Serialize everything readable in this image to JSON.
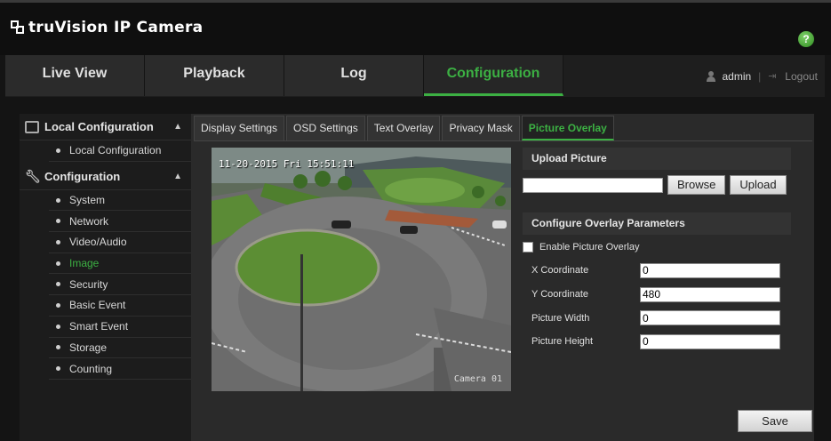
{
  "app": {
    "title": "truVision  IP Camera",
    "help_label": "?"
  },
  "nav": {
    "tabs": [
      {
        "label": "Live View"
      },
      {
        "label": "Playback"
      },
      {
        "label": "Log"
      },
      {
        "label": "Configuration"
      }
    ],
    "active_tab": "Configuration",
    "user": "admin",
    "separator": "|",
    "logout_label": "Logout"
  },
  "sidebar": {
    "local_header": "Local Configuration",
    "local_items": [
      {
        "label": "Local Configuration"
      }
    ],
    "config_header": "Configuration",
    "config_items": [
      {
        "label": "System"
      },
      {
        "label": "Network"
      },
      {
        "label": "Video/Audio"
      },
      {
        "label": "Image"
      },
      {
        "label": "Security"
      },
      {
        "label": "Basic Event"
      },
      {
        "label": "Smart Event"
      },
      {
        "label": "Storage"
      },
      {
        "label": "Counting"
      }
    ],
    "active_item": "Image"
  },
  "subtabs": [
    {
      "label": "Display Settings"
    },
    {
      "label": "OSD Settings"
    },
    {
      "label": "Text Overlay"
    },
    {
      "label": "Privacy Mask"
    },
    {
      "label": "Picture Overlay"
    }
  ],
  "active_subtab": "Picture Overlay",
  "preview": {
    "osd_date": "11-20-2015  Fri 15:51:11",
    "osd_camera": "Camera 01"
  },
  "upload": {
    "header": "Upload Picture",
    "browse_label": "Browse",
    "upload_label": "Upload"
  },
  "overlay": {
    "header": "Configure Overlay Parameters",
    "enable_label": "Enable Picture Overlay",
    "enabled": false,
    "fields": [
      {
        "label": "X Coordinate",
        "value": "0"
      },
      {
        "label": "Y Coordinate",
        "value": "480"
      },
      {
        "label": "Picture Width",
        "value": "0"
      },
      {
        "label": "Picture Height",
        "value": "0"
      }
    ]
  },
  "save_label": "Save",
  "colors": {
    "accent": "#3cb043",
    "background": "#141414",
    "panel": "#2a2a2a"
  }
}
